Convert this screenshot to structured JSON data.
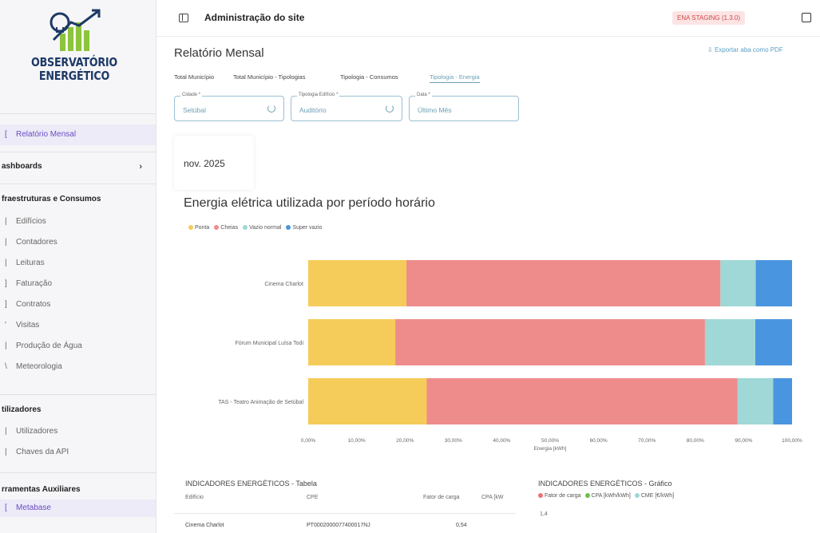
{
  "sidebar": {
    "logo_line1": "OBSERVATÓRIO",
    "logo_line2": "ENERGÉTICO",
    "active_item": "Relatório Mensal",
    "dashboards": "ashboards",
    "section_infra": "fraestruturas e Consumos",
    "infra_items": [
      "Edifícios",
      "Contadores",
      "Leituras",
      "Faturação",
      "Contratos",
      "Visitas",
      "Produção de Água",
      "Meteorologia"
    ],
    "section_users": "tilizadores",
    "user_items": [
      "Utilizadores",
      "Chaves da API"
    ],
    "section_tools": "rramentas Auxiliares",
    "tools_items": [
      "Metabase"
    ]
  },
  "topbar": {
    "title": "Administração do site",
    "env_badge": "ENA STAGING (1.3.0)"
  },
  "page": {
    "title": "Relatório Mensal",
    "export_label": "Exportar aba como PDF",
    "tabs": [
      "Total Município",
      "Total Município - Tipologias",
      "Tipologia - Consumos",
      "Tipologia - Energia"
    ],
    "active_tab": 3
  },
  "filters": [
    {
      "label": "Cidade *",
      "value": "Setúbal"
    },
    {
      "label": "Tipologia Edifício *",
      "value": "Auditório"
    },
    {
      "label": "Data *",
      "value": "Último Mês"
    }
  ],
  "month_card": "nov. 2025",
  "chart_title": "Energia elétrica utilizada por período horário",
  "chart_data": {
    "type": "bar",
    "orientation": "horizontal",
    "stacked": true,
    "categories": [
      "Cinema Charlot",
      "Fórum Municipal Luísa Todi",
      "TAS - Teatro Animação de Setúbal"
    ],
    "series": [
      {
        "name": "Ponta",
        "color": "#f5cc5a",
        "values": [
          20.3,
          18.0,
          24.5
        ]
      },
      {
        "name": "Cheias",
        "color": "#ee8c8c",
        "values": [
          64.9,
          64.0,
          64.2
        ]
      },
      {
        "name": "Vazio normal",
        "color": "#9fd8d6",
        "values": [
          7.3,
          10.4,
          7.4
        ]
      },
      {
        "name": "Super vazio",
        "color": "#4a95e0",
        "values": [
          7.5,
          7.6,
          3.9
        ]
      }
    ],
    "xlabel": "Energia [kWh]",
    "xticks": [
      "0,00%",
      "10,00%",
      "20,00%",
      "30,00%",
      "40,00%",
      "50,00%",
      "60,00%",
      "70,00%",
      "80,00%",
      "90,00%",
      "100,00%"
    ],
    "xlim": [
      0,
      100
    ],
    "legend": "top-left"
  },
  "indicators": {
    "table_title": "INDICADORES ENERGÉTICOS - Tabela",
    "columns": [
      "Edifício",
      "CPE",
      "Fator de carga",
      "CPA [kW"
    ],
    "rows": [
      {
        "edificio": "Cinema Charlot",
        "cpe": "PT0002000077400017NJ",
        "fator": "0,54"
      }
    ],
    "graph_title": "INDICADORES ENERGÉTICOS - Gráfico",
    "graph_legend": [
      {
        "name": "Fator de carga",
        "color": "#ee7272"
      },
      {
        "name": "CPA [kWh/kWh]",
        "color": "#6cc04a"
      },
      {
        "name": "CME [€/kWh]",
        "color": "#9fd8d6"
      }
    ],
    "graph_y_first": "1,4"
  }
}
